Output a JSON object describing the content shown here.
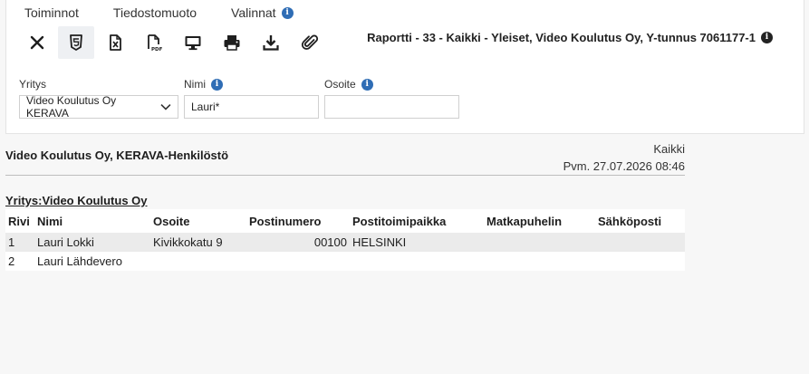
{
  "menu": {
    "items": [
      "Toiminnot",
      "Tiedostomuoto",
      "Valinnat"
    ]
  },
  "toolbar": {
    "buttons": [
      {
        "name": "close-icon",
        "label": "Sulje"
      },
      {
        "name": "html5-icon",
        "label": "HTML"
      },
      {
        "name": "excel-file-icon",
        "label": "Excel"
      },
      {
        "name": "pdf-file-icon",
        "label": "PDF"
      },
      {
        "name": "monitor-icon",
        "label": "Näyttö"
      },
      {
        "name": "printer-icon",
        "label": "Tulosta"
      },
      {
        "name": "download-icon",
        "label": "Lataa"
      },
      {
        "name": "paperclip-icon",
        "label": "Liite"
      }
    ]
  },
  "report_title": "Raportti - 33 - Kaikki - Yleiset, Video Koulutus Oy, Y-tunnus 7061177-1",
  "filters": {
    "company": {
      "label": "Yritys",
      "value": "Video Koulutus Oy KERAVA"
    },
    "name": {
      "label": "Nimi",
      "value": "Lauri*"
    },
    "address": {
      "label": "Osoite",
      "value": ""
    }
  },
  "report": {
    "org": "Video Koulutus Oy, KERAVA-Henkilöstö",
    "scope": "Kaikki",
    "date": "Pvm. 27.07.2026 08:46",
    "group": "Yritys:Video Koulutus Oy",
    "columns": [
      "Rivi",
      "Nimi",
      "Osoite",
      "Postinumero",
      "Postitoimipaikka",
      "Matkapuhelin",
      "Sähköposti"
    ],
    "rows": [
      [
        "1",
        "Lauri Lokki",
        "Kivikkokatu 9",
        "00100",
        "HELSINKI",
        "",
        ""
      ],
      [
        "2",
        "Lauri Lähdevero",
        "",
        "",
        "",
        "",
        ""
      ]
    ]
  },
  "colors": {
    "info_blue": "#2f6db5",
    "row_stripe": "#ebebeb"
  }
}
